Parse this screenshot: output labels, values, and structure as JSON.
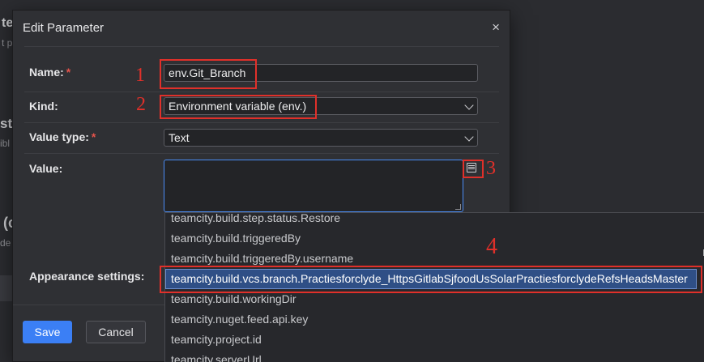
{
  "background": {
    "texts": [
      "te",
      "t p",
      "st",
      "ibl",
      "(c",
      "de"
    ]
  },
  "dialog": {
    "title": "Edit Parameter",
    "close_icon": "close-icon",
    "fields": {
      "name": {
        "label": "Name:",
        "required_mark": "*",
        "value": "env.Git_Branch"
      },
      "kind": {
        "label": "Kind:",
        "value": "Environment variable (env.)"
      },
      "value_type": {
        "label": "Value type:",
        "required_mark": "*",
        "value": "Text"
      },
      "value": {
        "label": "Value:",
        "value": "",
        "picker_icon": "parameter-list-icon"
      },
      "appearance": {
        "label": "Appearance settings:"
      }
    },
    "buttons": {
      "save": "Save",
      "cancel": "Cancel"
    }
  },
  "dropdown": {
    "items": [
      "teamcity.build.step.status.Restore",
      "teamcity.build.triggeredBy",
      "teamcity.build.triggeredBy.username",
      "teamcity.build.vcs.branch.Practiesforclyde_HttpsGitlabSjfoodUsSolarPractiesforclydeRefsHeadsMaster",
      "teamcity.build.workingDir",
      "teamcity.nuget.feed.api.key",
      "teamcity.project.id",
      "teamcity.serverUrl"
    ],
    "selected_index": 3,
    "scroll_indicator": "l"
  },
  "annotations": [
    "1",
    "2",
    "3",
    "4"
  ],
  "colors": {
    "accent": "#3b7ff5",
    "annotation": "#e0302a",
    "required": "#e5534b"
  }
}
